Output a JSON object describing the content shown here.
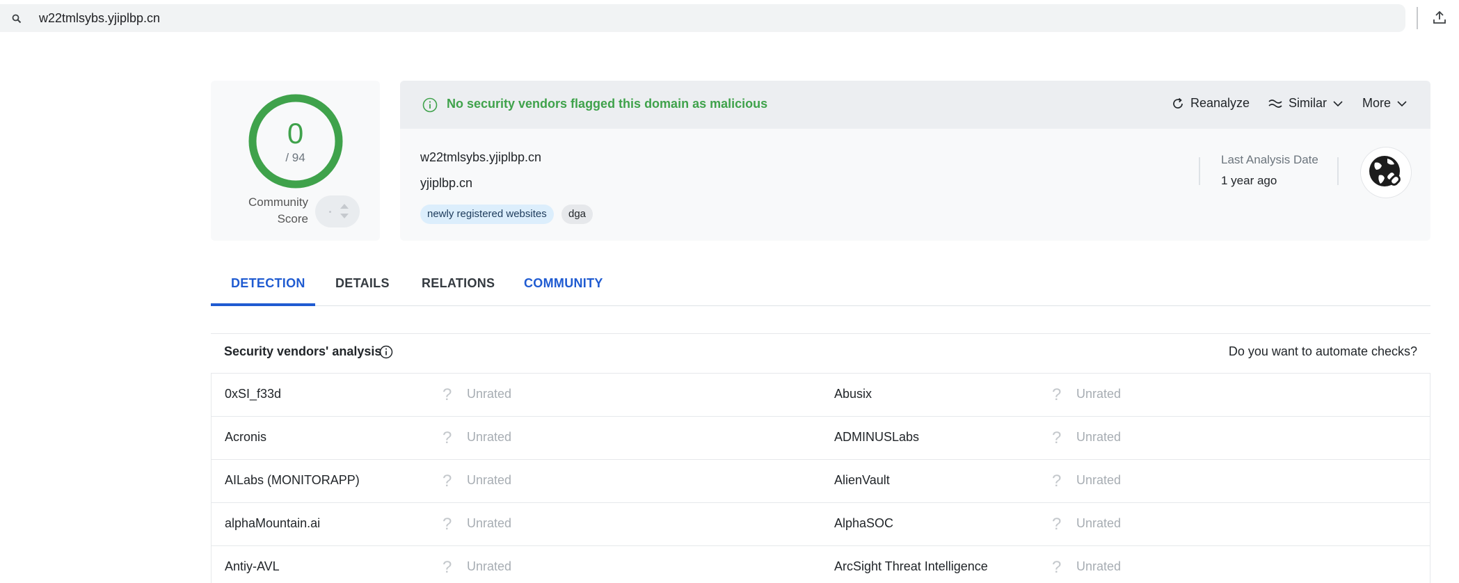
{
  "search": {
    "value": "w22tmlsybs.yjiplbp.cn"
  },
  "score": {
    "detections": "0",
    "total": "/ 94",
    "community_label": "Community Score"
  },
  "banner": {
    "text": "No security vendors flagged this domain as malicious"
  },
  "actions": {
    "reanalyze": "Reanalyze",
    "similar": "Similar",
    "more": "More"
  },
  "domain": {
    "name": "w22tmlsybs.yjiplbp.cn",
    "parent": "yjiplbp.cn",
    "tags": [
      "newly registered websites",
      "dga"
    ]
  },
  "last_analysis": {
    "label": "Last Analysis Date",
    "value": "1 year ago"
  },
  "tabs": [
    "DETECTION",
    "DETAILS",
    "RELATIONS",
    "COMMUNITY"
  ],
  "vendors": {
    "title": "Security vendors' analysis",
    "automate": "Do you want to automate checks?",
    "rows": [
      {
        "left": {
          "name": "0xSI_f33d",
          "status": "Unrated"
        },
        "right": {
          "name": "Abusix",
          "status": "Unrated"
        }
      },
      {
        "left": {
          "name": "Acronis",
          "status": "Unrated"
        },
        "right": {
          "name": "ADMINUSLabs",
          "status": "Unrated"
        }
      },
      {
        "left": {
          "name": "AILabs (MONITORAPP)",
          "status": "Unrated"
        },
        "right": {
          "name": "AlienVault",
          "status": "Unrated"
        }
      },
      {
        "left": {
          "name": "alphaMountain.ai",
          "status": "Unrated"
        },
        "right": {
          "name": "AlphaSOC",
          "status": "Unrated"
        }
      },
      {
        "left": {
          "name": "Antiy-AVL",
          "status": "Unrated"
        },
        "right": {
          "name": "ArcSight Threat Intelligence",
          "status": "Unrated"
        }
      }
    ]
  },
  "colors": {
    "accent": "#1f5bd1",
    "clean": "#3fa24b"
  }
}
